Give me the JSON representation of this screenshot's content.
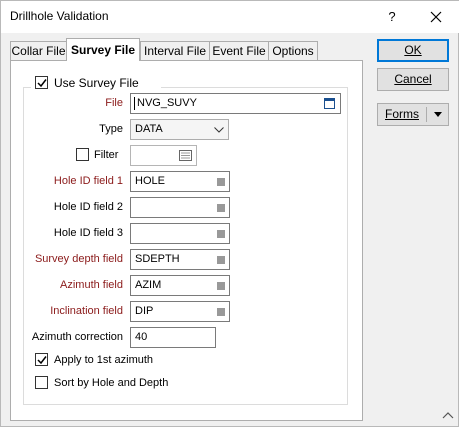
{
  "window": {
    "title": "Drillhole Validation",
    "help_label": "?"
  },
  "tabs": [
    {
      "label": "Collar File",
      "active": false
    },
    {
      "label": "Survey File",
      "active": true
    },
    {
      "label": "Interval File",
      "active": false
    },
    {
      "label": "Event File",
      "active": false
    },
    {
      "label": "Options",
      "active": false
    }
  ],
  "buttons": {
    "ok": "OK",
    "cancel": "Cancel",
    "forms": "Forms"
  },
  "survey": {
    "use_survey_file": {
      "label": "Use Survey File",
      "checked": true
    },
    "file": {
      "label": "File",
      "value": "NVG_SUVY"
    },
    "type": {
      "label": "Type",
      "value": "DATA"
    },
    "filter": {
      "label": "Filter",
      "checked": false,
      "value": ""
    },
    "hole_id_1": {
      "label": "Hole ID field 1",
      "value": "HOLE"
    },
    "hole_id_2": {
      "label": "Hole ID field 2",
      "value": ""
    },
    "hole_id_3": {
      "label": "Hole ID field 3",
      "value": ""
    },
    "survey_depth": {
      "label": "Survey depth field",
      "value": "SDEPTH"
    },
    "azimuth": {
      "label": "Azimuth field",
      "value": "AZIM"
    },
    "inclination": {
      "label": "Inclination field",
      "value": "DIP"
    },
    "azimuth_correction": {
      "label": "Azimuth correction",
      "value": "40"
    },
    "apply_first_azimuth": {
      "label": "Apply to 1st azimuth",
      "checked": true
    },
    "sort_by_hole_depth": {
      "label": "Sort by Hole and Depth",
      "checked": false
    }
  },
  "colors": {
    "required_label": "#8b1a1a",
    "focus_border": "#0078d7"
  },
  "icons": [
    "close-icon",
    "file-browse-icon",
    "chevron-down-icon",
    "filter-list-icon",
    "field-list-icon",
    "checkmark-icon",
    "resize-up-icon"
  ]
}
